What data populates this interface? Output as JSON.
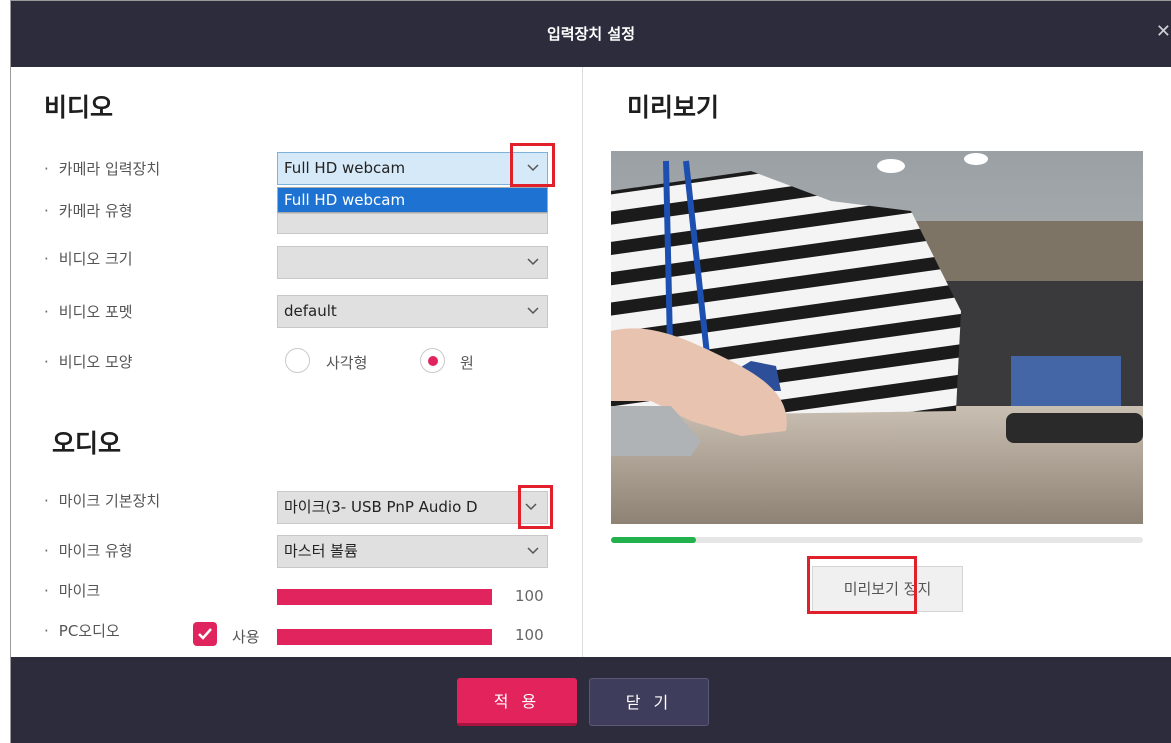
{
  "dialog": {
    "title": "입력장치 설정"
  },
  "video": {
    "title": "비디오",
    "camera_device": {
      "label": "카메라 입력장치",
      "value": "Full HD webcam",
      "dropdown_option": "Full HD webcam"
    },
    "camera_type": {
      "label": "카메라 유형",
      "value": ""
    },
    "video_size": {
      "label": "비디오 크기",
      "value": ""
    },
    "video_format": {
      "label": "비디오 포멧",
      "value": "default"
    },
    "video_shape": {
      "label": "비디오 모양",
      "options": [
        "사각형",
        "원"
      ],
      "selected": "원"
    }
  },
  "audio": {
    "title": "오디오",
    "mic_device": {
      "label": "마이크 기본장치",
      "value": "마이크(3- USB PnP Audio D"
    },
    "mic_type": {
      "label": "마이크 유형",
      "value": "마스터 볼륨"
    },
    "mic": {
      "label": "마이크",
      "value": "100"
    },
    "pc_audio": {
      "label": "PC오디오",
      "checkbox_label": "사용",
      "checked": true,
      "value": "100"
    }
  },
  "preview": {
    "title": "미리보기",
    "progress": 0.16,
    "stop_button_label": "미리보기 정지"
  },
  "footer": {
    "apply_label": "적 용",
    "close_label": "닫 기"
  },
  "colors": {
    "accent": "#e3245c",
    "titlebar": "#2d2c3d",
    "progress": "#22b14c",
    "highlight": "#e0202a"
  },
  "icons": {
    "close": "close-icon",
    "chevron": "chevron-down-icon",
    "check": "check-icon"
  }
}
